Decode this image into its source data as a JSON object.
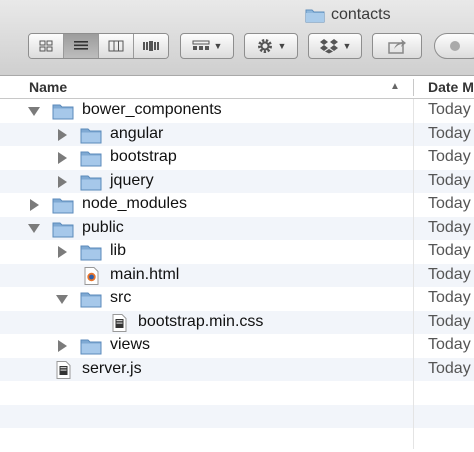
{
  "window": {
    "title": "contacts"
  },
  "toolbar": {
    "view_buttons": [
      "icon-view",
      "list-view",
      "column-view",
      "coverflow-view"
    ],
    "active_view": 1
  },
  "header": {
    "name_label": "Name",
    "date_label": "Date M"
  },
  "rows": [
    {
      "name": "bower_components",
      "type": "folder",
      "depth": 0,
      "disclosure": "open",
      "date": "Today"
    },
    {
      "name": "angular",
      "type": "folder",
      "depth": 1,
      "disclosure": "closed",
      "date": "Today"
    },
    {
      "name": "bootstrap",
      "type": "folder",
      "depth": 1,
      "disclosure": "closed",
      "date": "Today"
    },
    {
      "name": "jquery",
      "type": "folder",
      "depth": 1,
      "disclosure": "closed",
      "date": "Today"
    },
    {
      "name": "node_modules",
      "type": "folder",
      "depth": 0,
      "disclosure": "closed",
      "date": "Today"
    },
    {
      "name": "public",
      "type": "folder",
      "depth": 0,
      "disclosure": "open",
      "date": "Today"
    },
    {
      "name": "lib",
      "type": "folder",
      "depth": 1,
      "disclosure": "closed",
      "date": "Today"
    },
    {
      "name": "main.html",
      "type": "html",
      "depth": 1,
      "disclosure": "none",
      "date": "Today"
    },
    {
      "name": "src",
      "type": "folder",
      "depth": 1,
      "disclosure": "open",
      "date": "Today"
    },
    {
      "name": "bootstrap.min.css",
      "type": "file",
      "depth": 2,
      "disclosure": "none",
      "date": "Today"
    },
    {
      "name": "views",
      "type": "folder",
      "depth": 1,
      "disclosure": "closed",
      "date": "Today"
    },
    {
      "name": "server.js",
      "type": "file",
      "depth": 0,
      "disclosure": "none",
      "date": "Today"
    }
  ]
}
